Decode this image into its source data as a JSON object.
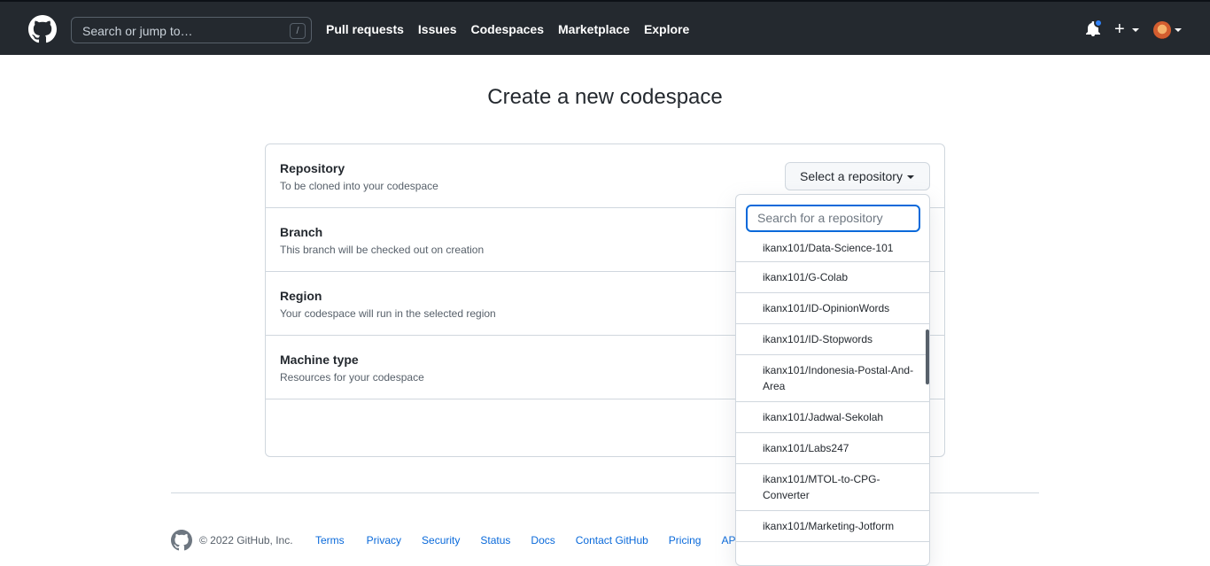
{
  "header": {
    "search_placeholder": "Search or jump to…",
    "search_shortcut": "/",
    "nav": [
      "Pull requests",
      "Issues",
      "Codespaces",
      "Marketplace",
      "Explore"
    ],
    "plus_label": "+"
  },
  "main": {
    "title": "Create a new codespace",
    "rows": [
      {
        "title": "Repository",
        "desc": "To be cloned into your codespace"
      },
      {
        "title": "Branch",
        "desc": "This branch will be checked out on creation"
      },
      {
        "title": "Region",
        "desc": "Your codespace will run in the selected region"
      },
      {
        "title": "Machine type",
        "desc": "Resources for your codespace"
      }
    ],
    "select_repo_label": "Select a repository"
  },
  "dropdown": {
    "search_placeholder": "Search for a repository",
    "items": [
      "ikanx101/Data-Science-101",
      "ikanx101/G-Colab",
      "ikanx101/ID-OpinionWords",
      "ikanx101/ID-Stopwords",
      "ikanx101/Indonesia-Postal-And-Area",
      "ikanx101/Jadwal-Sekolah",
      "ikanx101/Labs247",
      "ikanx101/MTOL-to-CPG-Converter",
      "ikanx101/Marketing-Jotform"
    ]
  },
  "footer": {
    "copyright": "© 2022 GitHub, Inc.",
    "links": [
      "Terms",
      "Privacy",
      "Security",
      "Status",
      "Docs",
      "Contact GitHub",
      "Pricing",
      "API"
    ]
  },
  "colors": {
    "header_bg": "#24292f",
    "accent_blue": "#0969da",
    "notification_dot": "#2f81f7"
  },
  "icons": [
    "github-logo-icon",
    "bell-icon",
    "plus-icon",
    "caret-down-icon",
    "avatar"
  ]
}
